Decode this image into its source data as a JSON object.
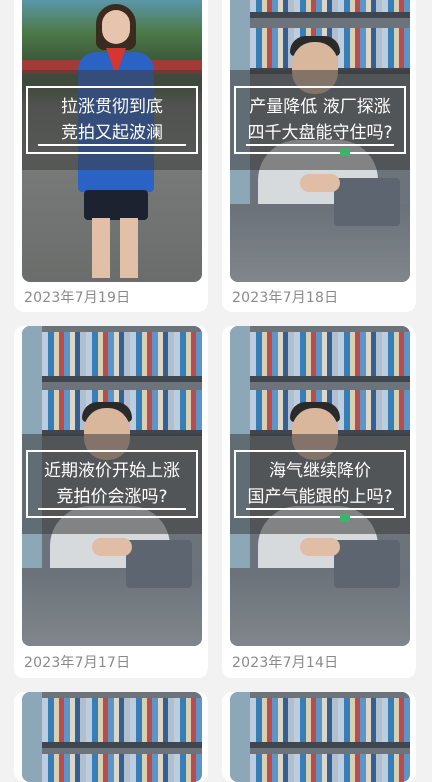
{
  "videos": [
    {
      "caption_lines": [
        "拉涨贯彻到底",
        "竞拍又起波澜"
      ],
      "date": "2023年7月19日"
    },
    {
      "caption_lines": [
        "产量降低 液厂探涨",
        "四千大盘能守住吗?"
      ],
      "date": "2023年7月18日"
    },
    {
      "caption_lines": [
        "近期液价开始上涨",
        "竞拍价会涨吗?"
      ],
      "date": "2023年7月17日"
    },
    {
      "caption_lines": [
        "海气继续降价",
        "国产气能跟的上吗?"
      ],
      "date": "2023年7月14日"
    }
  ]
}
